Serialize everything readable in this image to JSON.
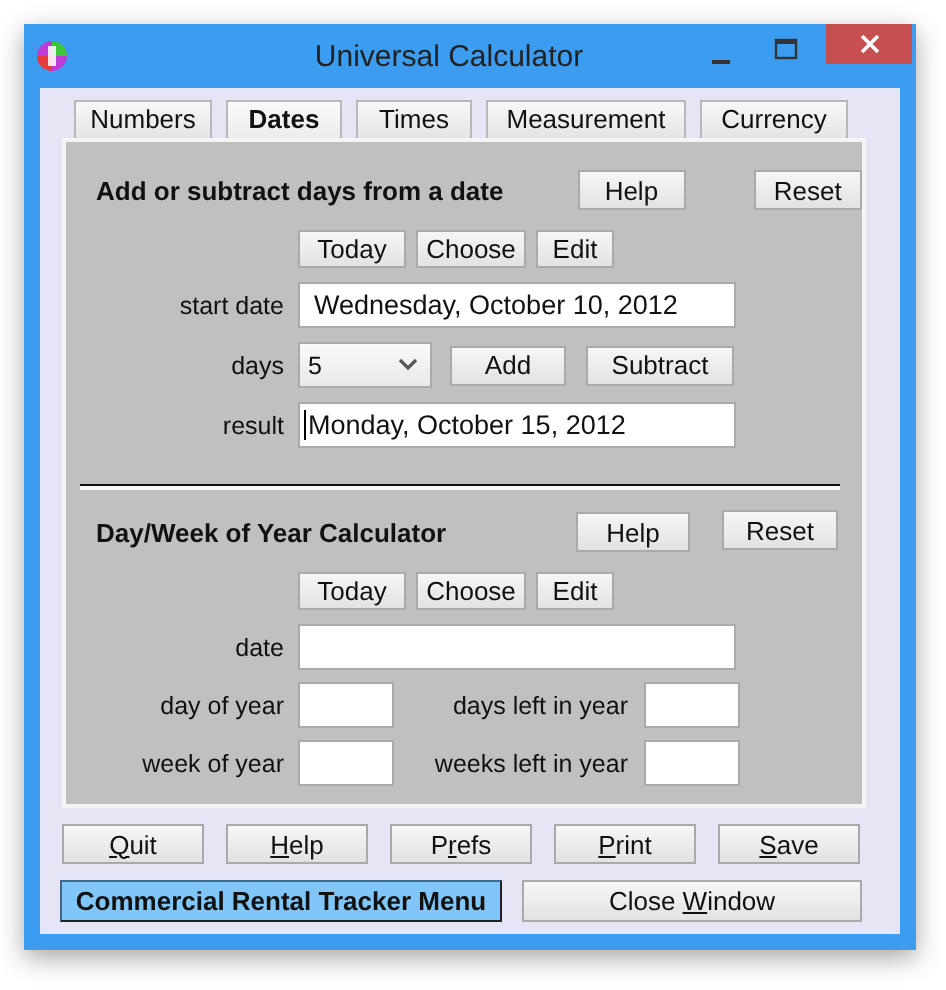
{
  "window": {
    "title": "Universal Calculator"
  },
  "tabs": [
    {
      "label": "Numbers",
      "selected": false
    },
    {
      "label": "Dates",
      "selected": true
    },
    {
      "label": "Times",
      "selected": false
    },
    {
      "label": "Measurement",
      "selected": false
    },
    {
      "label": "Currency",
      "selected": false
    }
  ],
  "add_section": {
    "title": "Add or subtract days from a date",
    "buttons": [
      "Help",
      "Reset"
    ],
    "date_buttons": [
      "Today",
      "Choose",
      "Edit"
    ],
    "start_date": {
      "label": "start date",
      "value": "Wednesday, October 10, 2012"
    },
    "days": {
      "label": "days",
      "value": "5",
      "buttons": [
        "Add",
        "Subtract"
      ]
    },
    "result": {
      "label": "result",
      "value": "Monday, October 15, 2012",
      "focused": true
    }
  },
  "year_section": {
    "title": "Day/Week of Year Calculator",
    "buttons": [
      "Help",
      "Reset"
    ],
    "date_buttons": [
      "Today",
      "Choose",
      "Edit"
    ],
    "date": {
      "label": "date"
    },
    "fields": [
      {
        "label": "day of year"
      },
      {
        "label": "days left in year"
      },
      {
        "label": "week of year"
      },
      {
        "label": "weeks left in year"
      }
    ]
  },
  "bottom_buttons": [
    {
      "key": "Q",
      "after": "uit"
    },
    {
      "key": "H",
      "after": "elp"
    },
    {
      "before": "P",
      "key": "r",
      "after": "efs"
    },
    {
      "key": "P",
      "after": "rint"
    },
    {
      "key": "S",
      "after": "ave"
    }
  ],
  "menu_button": "Commercial Rental Tracker Menu",
  "close_button": {
    "before": "Close ",
    "key": "W",
    "after": "indow"
  }
}
